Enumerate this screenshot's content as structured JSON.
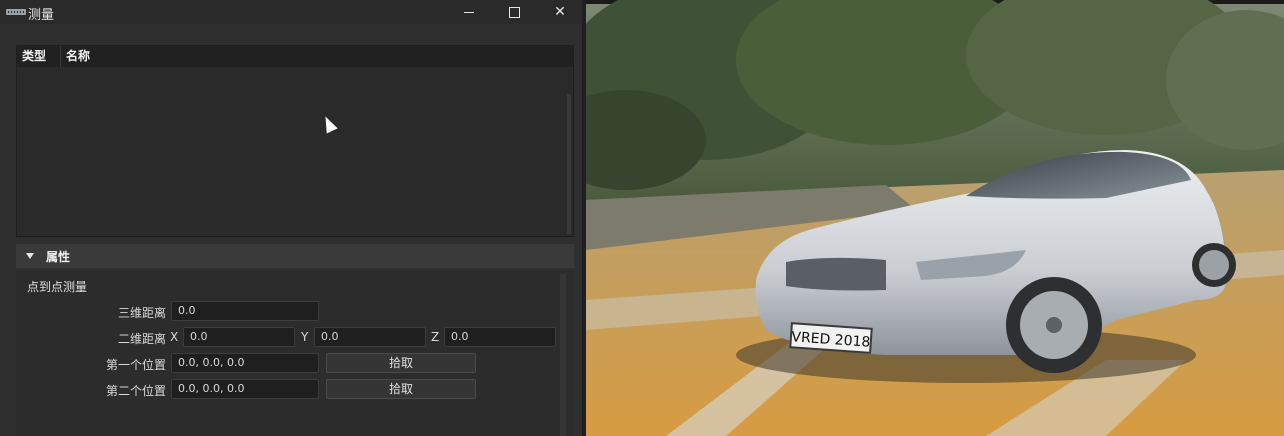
{
  "window": {
    "title": "测量",
    "maximize_icon": "maximize-icon",
    "close_label": "✕"
  },
  "table": {
    "columns": [
      "类型",
      "名称"
    ],
    "rows": []
  },
  "properties": {
    "header": "属性",
    "section": "点到点测量",
    "distance_3d_label": "三维距离",
    "distance_3d_value": "0.0",
    "distance_2d_label": "二维距离",
    "x_label": "X",
    "x_value": "0.0",
    "y_label": "Y",
    "y_value": "0.0",
    "z_label": "Z",
    "z_value": "0.0",
    "first_position_label": "第一个位置",
    "first_position_value": "0.0, 0.0, 0.0",
    "second_position_label": "第二个位置",
    "second_position_value": "0.0, 0.0, 0.0",
    "pick_label": "拾取"
  },
  "viewport": {
    "license_plate": "VRED 2018",
    "accent": "#5b9bd5"
  }
}
